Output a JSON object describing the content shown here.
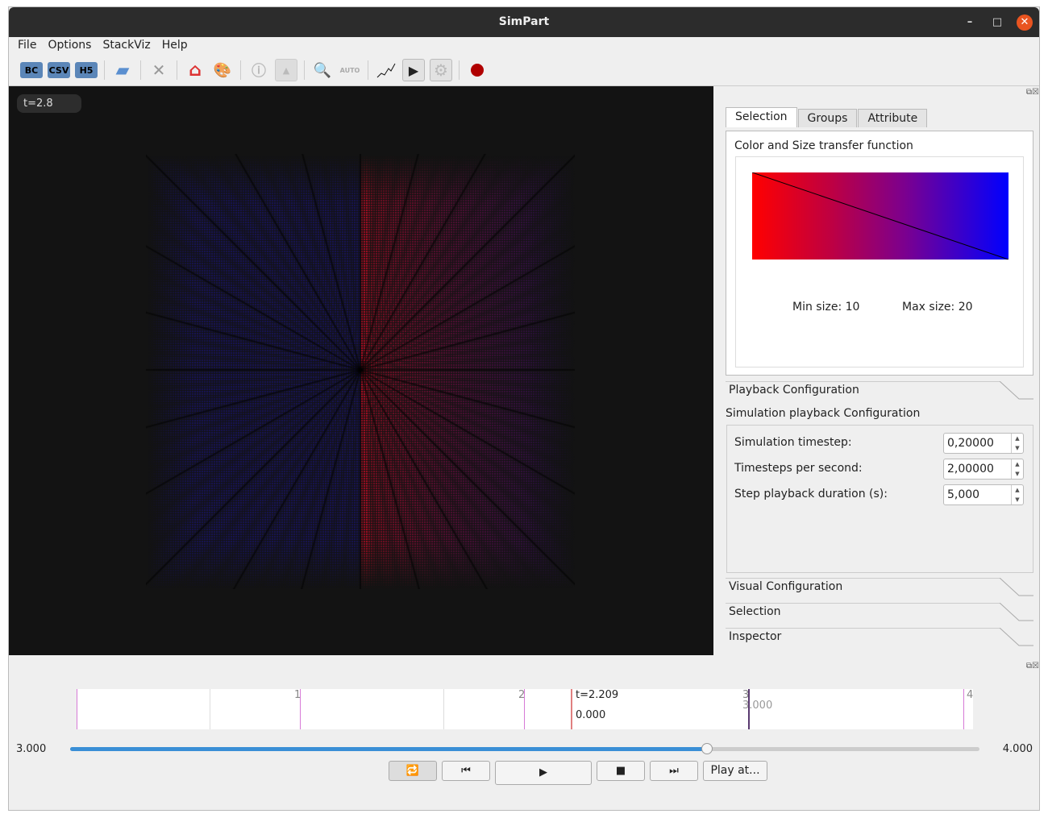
{
  "window": {
    "title": "SimPart"
  },
  "menu": [
    "File",
    "Options",
    "StackViz",
    "Help"
  ],
  "toolbar": {
    "bc": "BC",
    "csv": "CSV",
    "h5": "H5",
    "auto": "AUTO"
  },
  "viewport": {
    "time_label": "t=2.8"
  },
  "right_panel": {
    "tabs": [
      "Selection",
      "Groups",
      "Attribute"
    ],
    "active_tab": "Selection",
    "transfer_title": "Color and Size transfer function",
    "min_size": "Min size: 10",
    "max_size": "Max size: 20",
    "gradient_colors": [
      "#ff0000",
      "#0000ff"
    ],
    "playback_section": "Playback Configuration",
    "playback_subtitle": "Simulation playback Configuration",
    "fields": [
      {
        "label": "Simulation timestep:",
        "value": "0,20000"
      },
      {
        "label": "Timesteps per second:",
        "value": "2,00000"
      },
      {
        "label": "Step playback duration (s):",
        "value": "5,000"
      }
    ],
    "sections": [
      "Visual Configuration",
      "Selection",
      "Inspector"
    ]
  },
  "timeline": {
    "ticks": [
      "1",
      "2",
      "3",
      "4"
    ],
    "cursor_label": "t=2.209",
    "cursor_value": "0.000",
    "marker_value": "3.000",
    "range_start": "3.000",
    "range_end": "4.000",
    "slider_progress": 0.7
  },
  "controls": {
    "play_at": "Play at..."
  }
}
